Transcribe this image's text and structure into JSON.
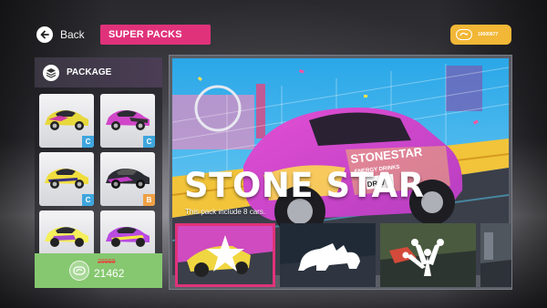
{
  "nav": {
    "back_label": "Back",
    "screen_title": "SUPER PACKS"
  },
  "wallet": {
    "amount": "10000677"
  },
  "package": {
    "header": "PACKAGE",
    "cars": [
      {
        "grade": "C",
        "body": "#e7d83c",
        "accent": "#d13aa6"
      },
      {
        "grade": "C",
        "body": "#d146c9",
        "accent": "#333333"
      },
      {
        "grade": "C",
        "body": "#f0de3f",
        "accent": "#3a2f88"
      },
      {
        "grade": "B",
        "body": "#2c2c34",
        "accent": "#c43cc6"
      },
      {
        "grade": "",
        "body": "#f4ef5a",
        "accent": "#a44bd0"
      },
      {
        "grade": "",
        "body": "#b84be0",
        "accent": "#f3ea42"
      }
    ],
    "old_price": "29999",
    "price": "21462"
  },
  "featured": {
    "title": "STONE STAR",
    "subtitle": "This pack include 8 cars.",
    "car_door_text": "STONESTAR",
    "car_subtext": "ENERGY DRINKS",
    "car_number_text": "DRW 3"
  },
  "packs": [
    {
      "icon": "star-icon",
      "selected": true
    },
    {
      "icon": "rhino-icon",
      "selected": false
    },
    {
      "icon": "frog-foot-icon",
      "selected": false
    },
    {
      "icon": "next-pack",
      "selected": false
    }
  ],
  "colors": {
    "accent_pink": "#e0327a",
    "buy_green": "#86c870",
    "gold": "#f2b736"
  }
}
